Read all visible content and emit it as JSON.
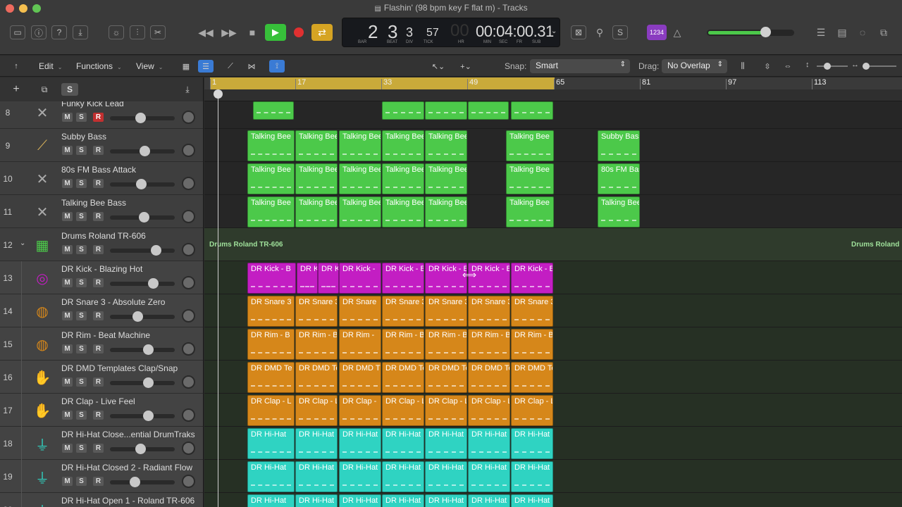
{
  "window": {
    "title": "Flashin' (98 bpm key F flat m) - Tracks"
  },
  "transport": {
    "bar": "2",
    "beat": "3",
    "div": "3",
    "tick": "57",
    "hr": "00",
    "time": "00:04:00.31",
    "labels": [
      "BAR",
      "BEAT",
      "DIV",
      "TICK",
      "HR",
      "MIN",
      "SEC",
      "FR",
      "SUB"
    ],
    "count_in": "1234"
  },
  "colors": {
    "green": "#4cc94a",
    "magenta": "#c31ec3",
    "orange": "#d6871a",
    "cyan": "#2fd3c2",
    "cycle": "#c9aa3a",
    "play": "#37c03a",
    "record": "#e03030"
  },
  "menus": {
    "edit": "Edit",
    "functions": "Functions",
    "view": "View"
  },
  "snap": {
    "label": "Snap:",
    "value": "Smart"
  },
  "drag": {
    "label": "Drag:",
    "value": "No Overlap"
  },
  "header": {
    "solo": "S"
  },
  "ruler": {
    "ticks": [
      "1",
      "17",
      "33",
      "49",
      "65",
      "81",
      "97",
      "113"
    ]
  },
  "buttons": {
    "m": "M",
    "s": "S",
    "r": "R"
  },
  "tracks": [
    {
      "num": "8",
      "name": "Funky Kick Lead",
      "icon": "synth-icon"
    },
    {
      "num": "9",
      "name": "Subby Bass",
      "icon": "bass-guitar-icon"
    },
    {
      "num": "10",
      "name": "80s FM Bass Attack",
      "icon": "synth-icon"
    },
    {
      "num": "11",
      "name": "Talking Bee Bass",
      "icon": "synth-icon"
    },
    {
      "num": "12",
      "name": "Drums Roland TR-606",
      "icon": "drum-machine-icon"
    },
    {
      "num": "13",
      "name": "DR Kick - Blazing Hot",
      "icon": "kick-drum-icon"
    },
    {
      "num": "14",
      "name": "DR Snare 3 - Absolute Zero",
      "icon": "snare-drum-icon"
    },
    {
      "num": "15",
      "name": "DR Rim - Beat Machine",
      "icon": "snare-drum-icon"
    },
    {
      "num": "16",
      "name": "DR DMD Templates Clap/Snap",
      "icon": "clap-icon"
    },
    {
      "num": "17",
      "name": "DR Clap - Live Feel",
      "icon": "clap-icon"
    },
    {
      "num": "18",
      "name": "DR Hi-Hat Close...ential DrumTraks",
      "icon": "hihat-icon"
    },
    {
      "num": "19",
      "name": "DR Hi-Hat Closed 2 - Radiant Flow",
      "icon": "hihat-icon"
    },
    {
      "num": "20",
      "name": "DR Hi-Hat Open 1 - Roland TR-606",
      "icon": "hihat-icon"
    }
  ],
  "lanes": [
    {
      "color": "green",
      "regions": [
        {
          "label": ""
        },
        {
          "label": ""
        },
        {
          "label": ""
        },
        {
          "label": ""
        },
        {
          "label": ""
        }
      ]
    },
    {
      "color": "green",
      "regions": [
        {
          "label": "Talking Bee"
        },
        {
          "label": "Talking Bee"
        },
        {
          "label": "Talking Bee"
        },
        {
          "label": "Talking Bee"
        },
        {
          "label": "Talking Bee"
        },
        {
          "label": "Talking Bee"
        },
        {
          "label": "Subby Bass"
        }
      ]
    },
    {
      "color": "green",
      "regions": [
        {
          "label": "Talking Bee"
        },
        {
          "label": "Talking Bee"
        },
        {
          "label": "Talking Bee"
        },
        {
          "label": "Talking Bee"
        },
        {
          "label": "Talking Bee"
        },
        {
          "label": "Talking Bee"
        },
        {
          "label": "80s FM Bas"
        }
      ]
    },
    {
      "color": "green",
      "regions": [
        {
          "label": "Talking Bee"
        },
        {
          "label": "Talking Bee"
        },
        {
          "label": "Talking Bee"
        },
        {
          "label": "Talking Bee"
        },
        {
          "label": "Talking Bee"
        },
        {
          "label": "Talking Bee"
        },
        {
          "label": "Talking Bee"
        }
      ]
    },
    {
      "folder": "Drums Roland TR-606",
      "folder_end": "Drums Roland"
    },
    {
      "color": "magenta",
      "regions": [
        {
          "label": "DR Kick - B"
        },
        {
          "label": "DR K"
        },
        {
          "label": "DR K"
        },
        {
          "label": "DR Kick -"
        },
        {
          "label": "DR Kick - Bl"
        },
        {
          "label": "DR Kick - B"
        },
        {
          "label": "DR Kick - Bl"
        },
        {
          "label": "DR Kick - Bl"
        }
      ]
    },
    {
      "color": "orange",
      "regions": [
        {
          "label": "DR Snare 3"
        },
        {
          "label": "DR Snare 3"
        },
        {
          "label": "DR Snare"
        },
        {
          "label": "DR Snare 3"
        },
        {
          "label": "DR Snare 3"
        },
        {
          "label": "DR Snare 3"
        },
        {
          "label": "DR Snare 3"
        }
      ]
    },
    {
      "color": "orange",
      "regions": [
        {
          "label": "DR Rim - B"
        },
        {
          "label": "DR Rim - B"
        },
        {
          "label": "DR Rim -"
        },
        {
          "label": "DR Rim - B"
        },
        {
          "label": "DR Rim - B"
        },
        {
          "label": "DR Rim - B"
        },
        {
          "label": "DR Rim - B"
        }
      ]
    },
    {
      "color": "orange",
      "regions": [
        {
          "label": "DR DMD Te"
        },
        {
          "label": "DR DMD Te"
        },
        {
          "label": "DR DMD T"
        },
        {
          "label": "DR DMD Te"
        },
        {
          "label": "DR DMD Te"
        },
        {
          "label": "DR DMD Te"
        },
        {
          "label": "DR DMD Te"
        }
      ]
    },
    {
      "color": "orange",
      "regions": [
        {
          "label": "DR Clap - L"
        },
        {
          "label": "DR Clap - Li"
        },
        {
          "label": "DR Clap -"
        },
        {
          "label": "DR Clap - Li"
        },
        {
          "label": "DR Clap - Li"
        },
        {
          "label": "DR Clap - Li"
        },
        {
          "label": "DR Clap - Li"
        }
      ]
    },
    {
      "color": "cyan",
      "regions": [
        {
          "label": "DR Hi-Hat"
        },
        {
          "label": "DR Hi-Hat"
        },
        {
          "label": "DR Hi-Hat"
        },
        {
          "label": "DR Hi-Hat"
        },
        {
          "label": "DR Hi-Hat"
        },
        {
          "label": "DR Hi-Hat"
        },
        {
          "label": "DR Hi-Hat"
        }
      ]
    },
    {
      "color": "cyan",
      "regions": [
        {
          "label": "DR Hi-Hat"
        },
        {
          "label": "DR Hi-Hat"
        },
        {
          "label": "DR Hi-Hat"
        },
        {
          "label": "DR Hi-Hat"
        },
        {
          "label": "DR Hi-Hat"
        },
        {
          "label": "DR Hi-Hat"
        },
        {
          "label": "DR Hi-Hat"
        }
      ]
    },
    {
      "color": "cyan",
      "regions": [
        {
          "label": "DR Hi-Hat"
        },
        {
          "label": "DR Hi-Hat"
        },
        {
          "label": "DR Hi-Hat"
        },
        {
          "label": "DR Hi-Hat"
        },
        {
          "label": "DR Hi-Hat"
        },
        {
          "label": "DR Hi-Hat"
        },
        {
          "label": "DR Hi-Hat"
        }
      ]
    }
  ]
}
